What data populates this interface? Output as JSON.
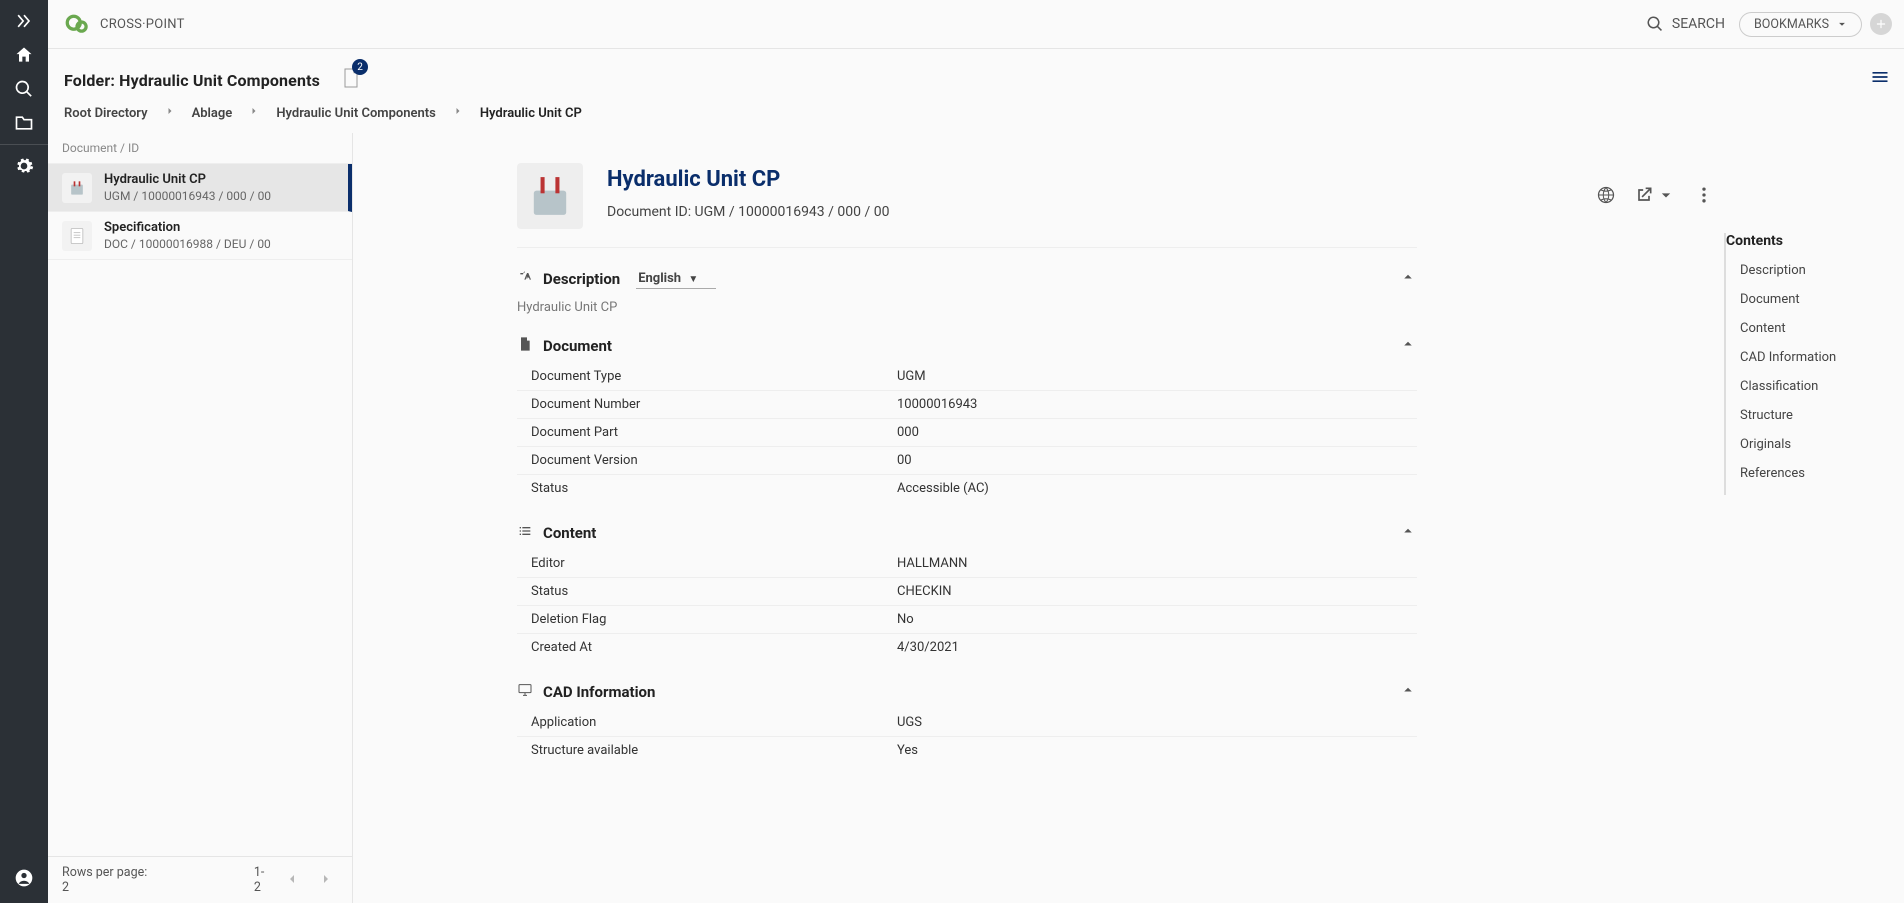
{
  "appbar": {
    "brand": "CROSS·POINT",
    "search_label": "SEARCH",
    "bookmarks_label": "BOOKMARKS"
  },
  "folder": {
    "title_prefix": "Folder: ",
    "title": "Hydraulic Unit Components",
    "badge_count": "2"
  },
  "breadcrumb": [
    "Root Directory",
    "Ablage",
    "Hydraulic Unit Components",
    "Hydraulic Unit CP"
  ],
  "doclist": {
    "header": "Document / ID",
    "items": [
      {
        "title": "Hydraulic Unit CP",
        "sub": "UGM / 10000016943 / 000 / 00",
        "selected": true,
        "type": "model"
      },
      {
        "title": "Specification",
        "sub": "DOC / 10000016988 / DEU / 00",
        "selected": false,
        "type": "doc"
      }
    ],
    "footer_rows": "Rows per page: 2",
    "footer_range": "1-2"
  },
  "detail": {
    "title": "Hydraulic Unit CP",
    "id_label": "Document ID: UGM / 10000016943 / 000 / 00",
    "description_label": "Description",
    "language_selected": "English",
    "description_text": "Hydraulic Unit CP",
    "sections": {
      "document": {
        "label": "Document",
        "rows": [
          {
            "k": "Document Type",
            "v": "UGM"
          },
          {
            "k": "Document Number",
            "v": "10000016943"
          },
          {
            "k": "Document Part",
            "v": "000"
          },
          {
            "k": "Document Version",
            "v": "00"
          },
          {
            "k": "Status",
            "v": "Accessible (AC)"
          }
        ]
      },
      "content": {
        "label": "Content",
        "rows": [
          {
            "k": "Editor",
            "v": "HALLMANN"
          },
          {
            "k": "Status",
            "v": "CHECKIN"
          },
          {
            "k": "Deletion Flag",
            "v": "No"
          },
          {
            "k": "Created At",
            "v": "4/30/2021"
          }
        ]
      },
      "cad": {
        "label": "CAD Information",
        "rows": [
          {
            "k": "Application",
            "v": "UGS"
          },
          {
            "k": "Structure available",
            "v": "Yes"
          }
        ]
      }
    }
  },
  "toc": {
    "title": "Contents",
    "items": [
      "Description",
      "Document",
      "Content",
      "CAD Information",
      "Classification",
      "Structure",
      "Originals",
      "References"
    ]
  }
}
